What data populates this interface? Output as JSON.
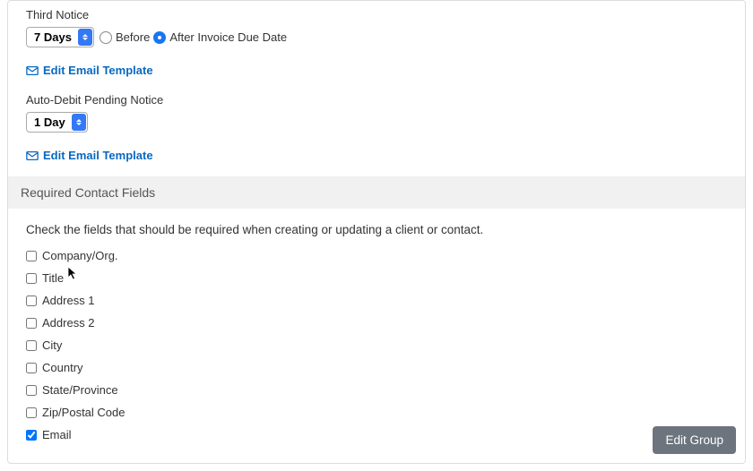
{
  "notices": {
    "third": {
      "label": "Third Notice",
      "select_value": "7 Days",
      "before_label": "Before",
      "after_label": "After Invoice Due Date",
      "timing": "after",
      "edit_link": "Edit Email Template"
    },
    "autodebit": {
      "label": "Auto-Debit Pending Notice",
      "select_value": "1 Day",
      "edit_link": "Edit Email Template"
    }
  },
  "contact_fields": {
    "header": "Required Contact Fields",
    "description": "Check the fields that should be required when creating or updating a client or contact.",
    "items": [
      {
        "label": "Company/Org.",
        "checked": false
      },
      {
        "label": "Title",
        "checked": false
      },
      {
        "label": "Address 1",
        "checked": false
      },
      {
        "label": "Address 2",
        "checked": false
      },
      {
        "label": "City",
        "checked": false
      },
      {
        "label": "Country",
        "checked": false
      },
      {
        "label": "State/Province",
        "checked": false
      },
      {
        "label": "Zip/Postal Code",
        "checked": false
      },
      {
        "label": "Email",
        "checked": true
      }
    ]
  },
  "edit_group_label": "Edit Group"
}
